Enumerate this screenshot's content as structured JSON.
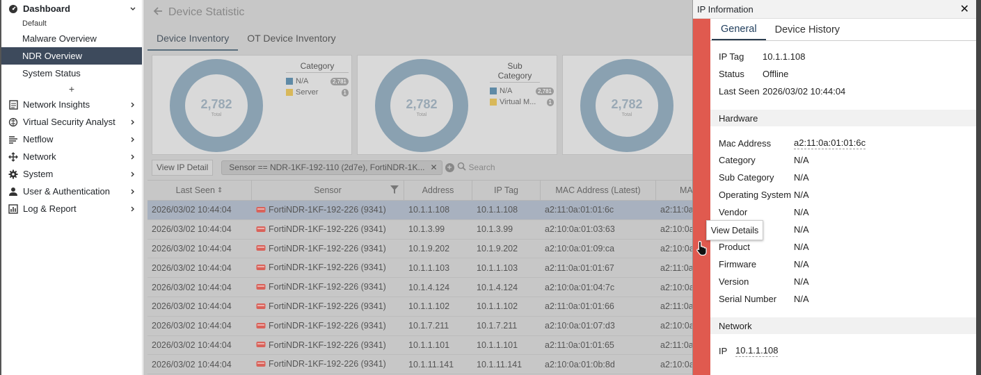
{
  "sidebar": {
    "dashboard": "Dashboard",
    "default_label": "Default",
    "items": [
      {
        "label": "Malware Overview",
        "active": false
      },
      {
        "label": "NDR Overview",
        "active": true
      },
      {
        "label": "System Status",
        "active": false
      }
    ],
    "sections": [
      {
        "label": "Network Insights",
        "icon": "document-icon"
      },
      {
        "label": "Virtual Security Analyst",
        "icon": "brain-icon"
      },
      {
        "label": "Netflow",
        "icon": "netflow-icon"
      },
      {
        "label": "Network",
        "icon": "move-icon"
      },
      {
        "label": "System",
        "icon": "gear-icon"
      },
      {
        "label": "User & Authentication",
        "icon": "user-icon"
      },
      {
        "label": "Log & Report",
        "icon": "chart-icon"
      }
    ]
  },
  "main": {
    "title": "Device Statistic",
    "tabs": [
      "Device Inventory",
      "OT Device Inventory"
    ],
    "panels": [
      {
        "total": "2,782",
        "total_label": "Total",
        "legend_title": "Category",
        "legend": [
          {
            "label": "N/A",
            "badge": "2,781",
            "color": "#5f8aa6"
          },
          {
            "label": "Server",
            "badge": "1",
            "color": "#d8b85a"
          }
        ]
      },
      {
        "total": "2,782",
        "total_label": "Total",
        "legend_title": "Sub Category",
        "legend": [
          {
            "label": "N/A",
            "badge": "2,781",
            "color": "#5f8aa6"
          },
          {
            "label": "Virtual M...",
            "badge": "1",
            "color": "#d8b85a"
          }
        ]
      },
      {
        "total": "2,782",
        "total_label": "Total"
      }
    ],
    "view_ip_detail": "View IP Detail",
    "filter_chip": "Sensor == NDR-1KF-192-110 (2d7e), FortiNDR-1K...",
    "search_placeholder": "Search",
    "columns": [
      "Last Seen",
      "Sensor",
      "Address",
      "IP Tag",
      "MAC Address (Latest)",
      "MA"
    ],
    "rows": [
      {
        "last_seen": "2026/03/02 10:44:04",
        "sensor": "FortiNDR-1KF-192-226 (9341)",
        "address": "10.1.1.108",
        "ip_tag": "10.1.1.108",
        "mac": "a2:11:0a:01:01:6c",
        "mac2": "a2:11:0a"
      },
      {
        "last_seen": "2026/03/02 10:44:04",
        "sensor": "FortiNDR-1KF-192-226 (9341)",
        "address": "10.1.3.99",
        "ip_tag": "10.1.3.99",
        "mac": "a2:10:0a:01:03:63",
        "mac2": "a2:10:0a"
      },
      {
        "last_seen": "2026/03/02 10:44:04",
        "sensor": "FortiNDR-1KF-192-226 (9341)",
        "address": "10.1.9.202",
        "ip_tag": "10.1.9.202",
        "mac": "a2:10:0a:01:09:ca",
        "mac2": "a2:10:0a"
      },
      {
        "last_seen": "2026/03/02 10:44:04",
        "sensor": "FortiNDR-1KF-192-226 (9341)",
        "address": "10.1.1.103",
        "ip_tag": "10.1.1.103",
        "mac": "a2:11:0a:01:01:67",
        "mac2": "a2:11:0a"
      },
      {
        "last_seen": "2026/03/02 10:44:04",
        "sensor": "FortiNDR-1KF-192-226 (9341)",
        "address": "10.1.4.124",
        "ip_tag": "10.1.4.124",
        "mac": "a2:10:0a:01:04:7c",
        "mac2": "a2:10:0a"
      },
      {
        "last_seen": "2026/03/02 10:44:04",
        "sensor": "FortiNDR-1KF-192-226 (9341)",
        "address": "10.1.1.102",
        "ip_tag": "10.1.1.102",
        "mac": "a2:11:0a:01:01:66",
        "mac2": "a2:11:0a"
      },
      {
        "last_seen": "2026/03/02 10:44:04",
        "sensor": "FortiNDR-1KF-192-226 (9341)",
        "address": "10.1.7.211",
        "ip_tag": "10.1.7.211",
        "mac": "a2:10:0a:01:07:d3",
        "mac2": "a2:10:0a"
      },
      {
        "last_seen": "2026/03/02 10:44:04",
        "sensor": "FortiNDR-1KF-192-226 (9341)",
        "address": "10.1.1.101",
        "ip_tag": "10.1.1.101",
        "mac": "a2:11:0a:01:01:65",
        "mac2": "a2:11:0a"
      },
      {
        "last_seen": "2026/03/02 10:44:04",
        "sensor": "FortiNDR-1KF-192-226 (9341)",
        "address": "10.1.11.141",
        "ip_tag": "10.1.11.141",
        "mac": "a2:10:0a:01:0b:8d",
        "mac2": "a2:10:0a"
      }
    ]
  },
  "dialog": {
    "title": "IP Information",
    "tabs": [
      "General",
      "Device History"
    ],
    "general": {
      "ip_tag_label": "IP Tag",
      "ip_tag": "10.1.1.108",
      "status_label": "Status",
      "status": "Offline",
      "last_seen_label": "Last Seen",
      "last_seen": "2026/03/02 10:44:04"
    },
    "hardware_title": "Hardware",
    "hardware": [
      {
        "k": "Mac Address",
        "v": "a2:11:0a:01:01:6c"
      },
      {
        "k": "Category",
        "v": "N/A"
      },
      {
        "k": "Sub Category",
        "v": "N/A"
      },
      {
        "k": "Operating System",
        "v": "N/A"
      },
      {
        "k": "Vendor",
        "v": "N/A"
      },
      {
        "k": "",
        "v": "N/A"
      },
      {
        "k": "Product",
        "v": "N/A"
      },
      {
        "k": "Firmware",
        "v": "N/A"
      },
      {
        "k": "Version",
        "v": "N/A"
      },
      {
        "k": "Serial Number",
        "v": "N/A"
      }
    ],
    "network_title": "Network",
    "network_ip_label": "IP",
    "network_ip": "10.1.1.108",
    "tooltip": "View Details"
  }
}
